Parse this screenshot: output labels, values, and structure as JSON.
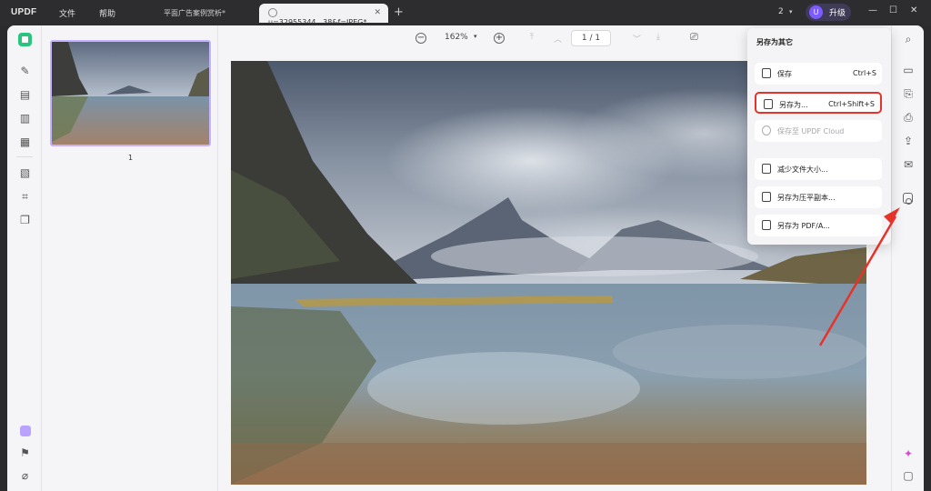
{
  "app": {
    "logo": "UPDF",
    "menu": [
      "文件",
      "帮助"
    ],
    "tabs": [
      {
        "label": "平面广告案例赏析*",
        "active": false
      },
      {
        "label": "u=32955344...38&f=JPEG*",
        "active": true
      }
    ],
    "window_count": "2",
    "upgrade": {
      "avatar": "U",
      "label": "升级"
    }
  },
  "toolbar": {
    "zoom": "162%",
    "page_current": "1",
    "page_total": "1"
  },
  "thumbnails": [
    {
      "page_label": "1"
    }
  ],
  "save_menu": {
    "title": "另存为其它",
    "items": [
      {
        "label": "保存",
        "shortcut": "Ctrl+S",
        "enabled": true,
        "highlighted": false
      },
      {
        "label": "另存为...",
        "shortcut": "Ctrl+Shift+S",
        "enabled": true,
        "highlighted": true
      },
      {
        "label": "保存至 UPDF Cloud",
        "shortcut": "",
        "enabled": false,
        "highlighted": false
      },
      {
        "label": "减少文件大小...",
        "shortcut": "",
        "enabled": true,
        "highlighted": false
      },
      {
        "label": "另存为压平副本...",
        "shortcut": "",
        "enabled": true,
        "highlighted": false
      },
      {
        "label": "另存为 PDF/A...",
        "shortcut": "",
        "enabled": true,
        "highlighted": false
      }
    ]
  },
  "colors": {
    "accent": "#7c5cff",
    "highlight_box": "#e5332a",
    "annotation_arrow": "#e5332a"
  }
}
